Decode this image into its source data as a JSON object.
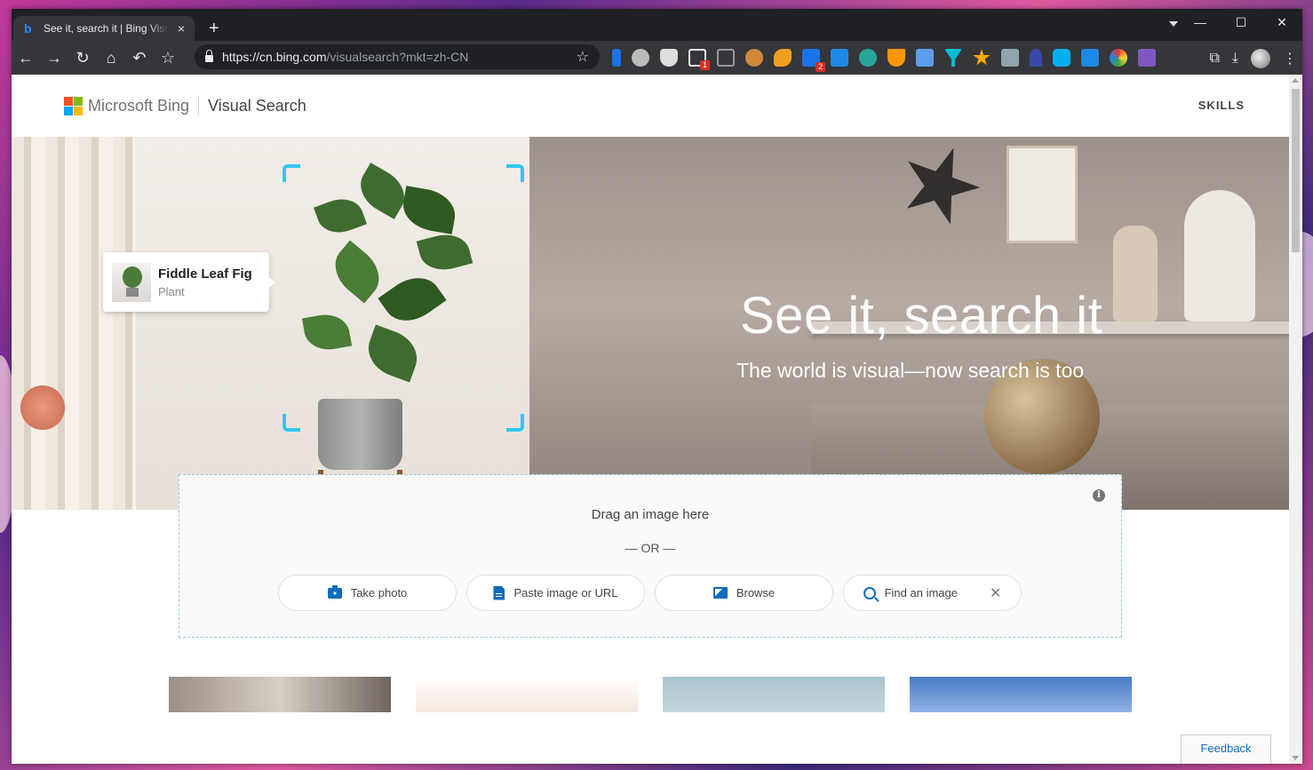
{
  "browser": {
    "tab_title": "See it, search it | Bing Visual Search",
    "tab_favicon": "bing-icon",
    "new_tab": "+",
    "url_host": "https://cn.bing.com",
    "url_path": "/visualsearch?mkt=zh-CN",
    "extension_badges": {
      "first": "1",
      "second": "2"
    }
  },
  "header": {
    "brand": "Microsoft Bing",
    "product": "Visual Search",
    "skills": "SKILLS",
    "logo_colors": [
      "#f25022",
      "#7fba00",
      "#00a4ef",
      "#ffb900"
    ]
  },
  "hero": {
    "title": "See it, search it",
    "subtitle": "The world is visual—now search is too",
    "result_card": {
      "name": "Fiddle Leaf Fig",
      "type": "Plant"
    },
    "selection_color": "#31c7f0"
  },
  "dropzone": {
    "drag_text": "Drag an image here",
    "or_text": "— OR —",
    "info_icon": "i",
    "buttons": [
      {
        "label": "Take photo",
        "icon": "camera-icon"
      },
      {
        "label": "Paste image or URL",
        "icon": "document-icon"
      },
      {
        "label": "Browse",
        "icon": "image-icon"
      },
      {
        "label": "Find an image",
        "icon": "search-icon"
      }
    ]
  },
  "feedback": "Feedback",
  "accent_color": "#0f6cbd"
}
